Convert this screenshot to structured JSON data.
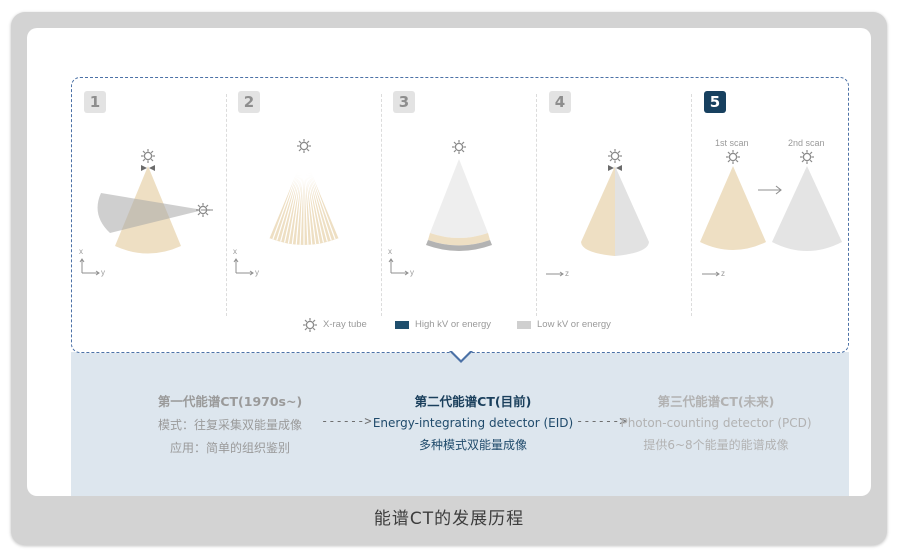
{
  "panels": [
    {
      "number": "1",
      "axis_a": "x",
      "axis_b": "y"
    },
    {
      "number": "2",
      "axis_a": "x",
      "axis_b": "y"
    },
    {
      "number": "3",
      "axis_a": "x",
      "axis_b": "y"
    },
    {
      "number": "4",
      "axis_a": "",
      "axis_b": "z"
    },
    {
      "number": "5",
      "axis_a": "",
      "axis_b": "z",
      "scan1": "1st scan",
      "scan2": "2nd scan"
    }
  ],
  "active_panel": "5",
  "legend": {
    "tube": "X-ray tube",
    "high": "High kV or energy",
    "low": "Low kV or energy"
  },
  "colors": {
    "high": "#1f4f6d",
    "low": "#cfcfcf",
    "beam": "#eedfc3",
    "frame": "#4b71a6"
  },
  "generations": [
    {
      "title": "第一代能谱CT(1970s~)",
      "line2": "模式：往复采集双能量成像",
      "line3": "应用：简单的组织鉴别"
    },
    {
      "title": "第二代能谱CT(目前)",
      "line2": "Energy-integrating detector (EID)",
      "line3": "多种模式双能量成像"
    },
    {
      "title": "第三代能谱CT(未来)",
      "line2": "Photon-counting detector (PCD)",
      "line3": "提供6~8个能量的能谱成像"
    }
  ],
  "arrow_text": "------>",
  "caption": "能谱CT的发展历程"
}
